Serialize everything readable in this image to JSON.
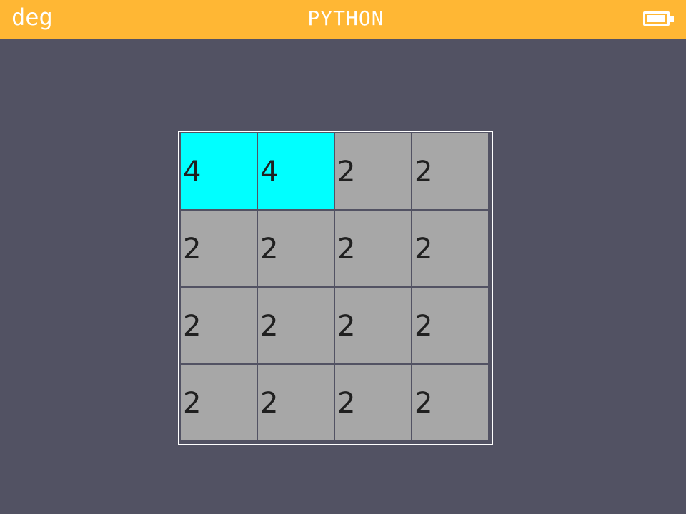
{
  "status_bar": {
    "angle_mode": "deg",
    "title": "PYTHON",
    "battery_icon": "battery-full-icon",
    "background_color": "#ffb734"
  },
  "board": {
    "background_color": "#525263",
    "highlight_color": "#00ffff",
    "tile_color": "#a7a7a7",
    "rows": [
      [
        {
          "value": "4",
          "highlighted": true
        },
        {
          "value": "4",
          "highlighted": true
        },
        {
          "value": "2",
          "highlighted": false
        },
        {
          "value": "2",
          "highlighted": false
        }
      ],
      [
        {
          "value": "2",
          "highlighted": false
        },
        {
          "value": "2",
          "highlighted": false
        },
        {
          "value": "2",
          "highlighted": false
        },
        {
          "value": "2",
          "highlighted": false
        }
      ],
      [
        {
          "value": "2",
          "highlighted": false
        },
        {
          "value": "2",
          "highlighted": false
        },
        {
          "value": "2",
          "highlighted": false
        },
        {
          "value": "2",
          "highlighted": false
        }
      ],
      [
        {
          "value": "2",
          "highlighted": false
        },
        {
          "value": "2",
          "highlighted": false
        },
        {
          "value": "2",
          "highlighted": false
        },
        {
          "value": "2",
          "highlighted": false
        }
      ]
    ]
  }
}
